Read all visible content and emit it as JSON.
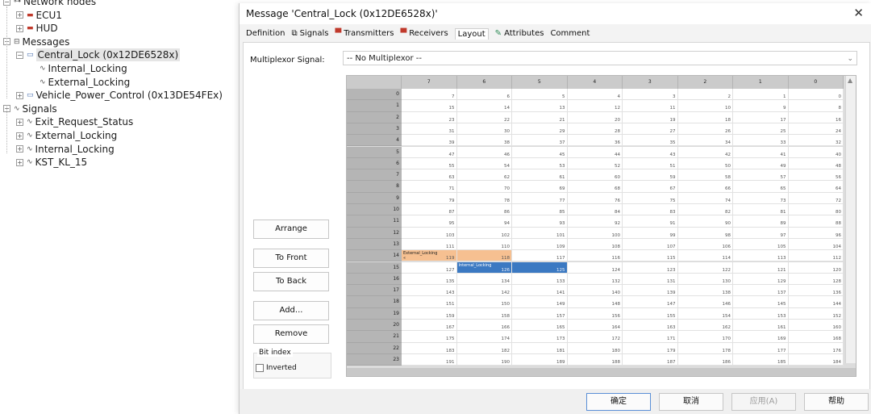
{
  "tree": {
    "items": [
      {
        "label": "Network nodes",
        "level": 0,
        "icon": "network-icon",
        "expander": "−"
      },
      {
        "label": "ECU1",
        "level": 1,
        "icon": "ecu-icon",
        "expander": "+"
      },
      {
        "label": "HUD",
        "level": 1,
        "icon": "ecu-icon",
        "expander": "+"
      },
      {
        "label": "Messages",
        "level": 0,
        "icon": "messages-icon",
        "expander": "−"
      },
      {
        "label": "Central_Lock (0x12DE6528x)",
        "level": 1,
        "icon": "message-icon",
        "expander": "−",
        "selected": true
      },
      {
        "label": "Internal_Locking",
        "level": 2,
        "icon": "signal-icon"
      },
      {
        "label": "External_Locking",
        "level": 2,
        "icon": "signal-icon"
      },
      {
        "label": "Vehicle_Power_Control (0x13DE54FEx)",
        "level": 1,
        "icon": "message-icon",
        "expander": "+"
      },
      {
        "label": "Signals",
        "level": 0,
        "icon": "signals-icon",
        "expander": "−"
      },
      {
        "label": "Exit_Request_Status",
        "level": 1,
        "icon": "signal-icon",
        "expander": "+"
      },
      {
        "label": "External_Locking",
        "level": 1,
        "icon": "signal-icon",
        "expander": "+"
      },
      {
        "label": "Internal_Locking",
        "level": 1,
        "icon": "signal-icon",
        "expander": "+"
      },
      {
        "label": "KST_KL_15",
        "level": 1,
        "icon": "signal-icon",
        "expander": "+"
      }
    ]
  },
  "dialog": {
    "title": "Message 'Central_Lock (0x12DE6528x)'",
    "close": "✕",
    "tabs": [
      {
        "label": "Definition",
        "icon": ""
      },
      {
        "label": "Signals",
        "icon": "signals-tab-icon"
      },
      {
        "label": "Transmitters",
        "icon": "transmitters-tab-icon"
      },
      {
        "label": "Receivers",
        "icon": "receivers-tab-icon"
      },
      {
        "label": "Layout",
        "icon": "",
        "active": true
      },
      {
        "label": "Attributes",
        "icon": "attributes-tab-icon"
      },
      {
        "label": "Comment",
        "icon": ""
      }
    ],
    "mux": {
      "label": "Multiplexor Signal:",
      "value": "-- No Multiplexor --"
    },
    "buttons": {
      "arrange": "Arrange",
      "front": "To Front",
      "back": "To Back",
      "add": "Add...",
      "remove": "Remove"
    },
    "bitindex": {
      "label": "Bit index",
      "inverted": "Inverted",
      "inverted_checked": false
    },
    "footer": {
      "ok": "确定",
      "cancel": "取消",
      "apply": "应用(A)",
      "help": "帮助"
    }
  },
  "grid": {
    "columns": [
      "7",
      "6",
      "5",
      "4",
      "3",
      "2",
      "1",
      "0"
    ],
    "rows": 24,
    "signals": [
      {
        "name": "External_Locking",
        "row": 14,
        "col_start": 0,
        "col_end": 1,
        "color": "#f6c091",
        "bits": [
          "119",
          "118"
        ],
        "start_mark": "«"
      },
      {
        "name": "Internal_Locking",
        "row": 15,
        "col_start": 1,
        "col_end": 2,
        "color": "#3b79c2",
        "bits": [
          "126",
          "125"
        ]
      }
    ]
  }
}
